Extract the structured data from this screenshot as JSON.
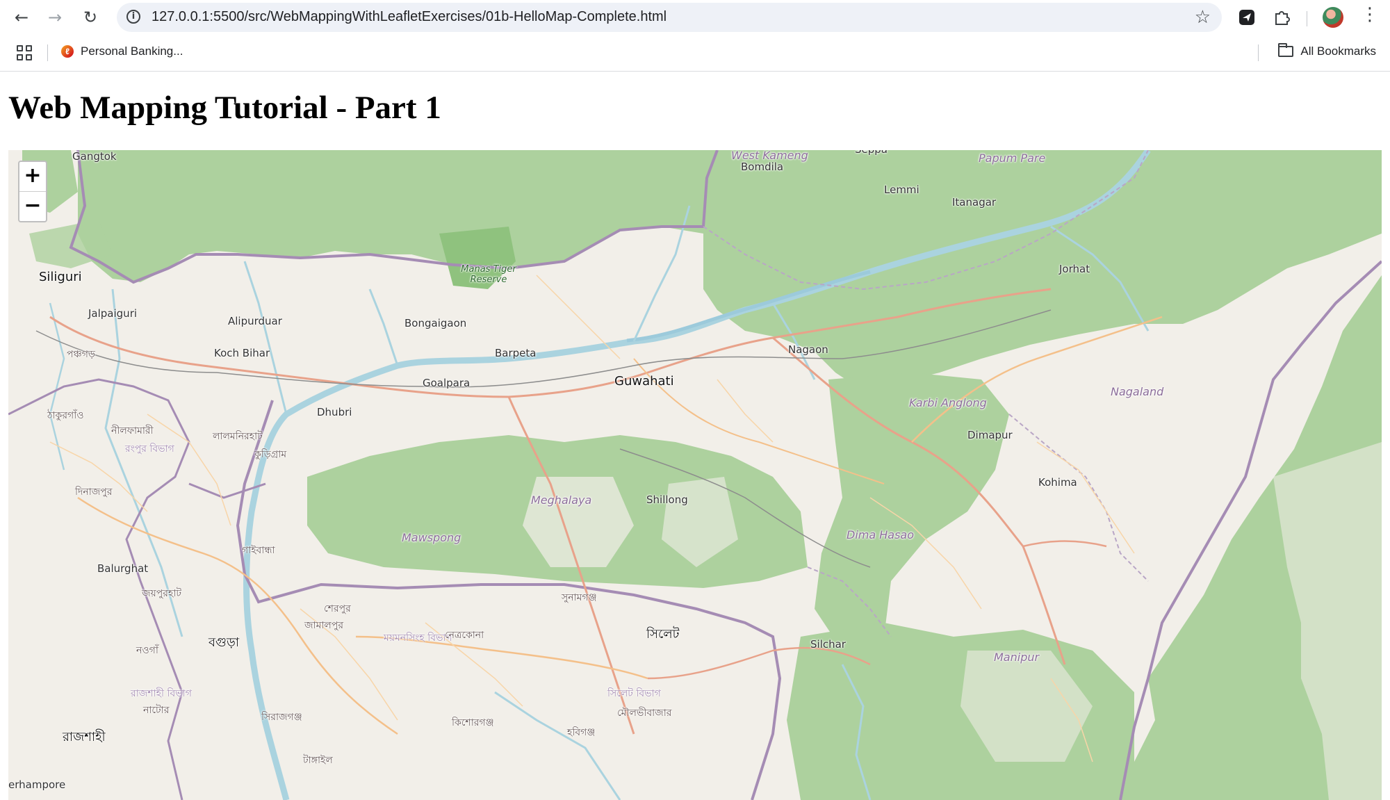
{
  "browser": {
    "url": "127.0.0.1:5500/src/WebMappingWithLeafletExercises/01b-HelloMap-Complete.html",
    "bookmark_personal": "Personal Banking...",
    "bookmark_all": "All Bookmarks"
  },
  "page": {
    "heading": "Web Mapping Tutorial - Part 1"
  },
  "map": {
    "zoom_in": "+",
    "zoom_out": "−",
    "labels": [
      {
        "text": "Gangtok"
      },
      {
        "text": "Siliguri"
      },
      {
        "text": "Jalpaiguri"
      },
      {
        "text": "Alipurduar"
      },
      {
        "text": "Koch Bihar"
      },
      {
        "text": "Bongaigaon"
      },
      {
        "text": "Barpeta"
      },
      {
        "text": "Goalpara"
      },
      {
        "text": "Dhubri"
      },
      {
        "text": "Guwahati"
      },
      {
        "text": "Nagaon"
      },
      {
        "text": "Jorhat"
      },
      {
        "text": "Dimapur"
      },
      {
        "text": "Kohima"
      },
      {
        "text": "Shillong"
      },
      {
        "text": "Silchar"
      },
      {
        "text": "Balurghat"
      },
      {
        "text": "West Kameng"
      },
      {
        "text": "Bomdila"
      },
      {
        "text": "Lemmi"
      },
      {
        "text": "Itanagar"
      },
      {
        "text": "Papum Pare"
      },
      {
        "text": "Seppa"
      },
      {
        "text": "Manas Tiger Reserve"
      },
      {
        "text": "Meghalaya"
      },
      {
        "text": "Mawspong"
      },
      {
        "text": "Karbi Anglong"
      },
      {
        "text": "Nagaland"
      },
      {
        "text": "Dima Hasao"
      },
      {
        "text": "Manipur"
      },
      {
        "text": "সিলেট"
      },
      {
        "text": "বগুড়া"
      },
      {
        "text": "রাজশাহী"
      },
      {
        "text": "রংপুর বিভাগ"
      },
      {
        "text": "ময়মনসিংহ বিভাগ"
      },
      {
        "text": "সিলেট বিভাগ"
      },
      {
        "text": "রাজশাহী বিভাগ"
      },
      {
        "text": "সুনামগঞ্জ"
      },
      {
        "text": "মৌলভীবাজার"
      },
      {
        "text": "হবিগঞ্জ"
      },
      {
        "text": "কিশোরগঞ্জ"
      },
      {
        "text": "টাঙ্গাইল"
      },
      {
        "text": "জামালপুর"
      },
      {
        "text": "শেরপুর"
      },
      {
        "text": "নেত্রকোনা"
      },
      {
        "text": "গাইবান্ধা"
      },
      {
        "text": "দিনাজপুর"
      },
      {
        "text": "নীলফামারী"
      },
      {
        "text": "ঠাকুরগাঁও"
      },
      {
        "text": "পঞ্চগড়"
      },
      {
        "text": "কুড়িগ্রাম"
      },
      {
        "text": "লালমনিরহাট"
      },
      {
        "text": "জয়পুরহাট"
      },
      {
        "text": "নওগাঁ"
      },
      {
        "text": "নাটোর"
      },
      {
        "text": "সিরাজগঞ্জ"
      },
      {
        "text": "erhampore"
      }
    ]
  }
}
